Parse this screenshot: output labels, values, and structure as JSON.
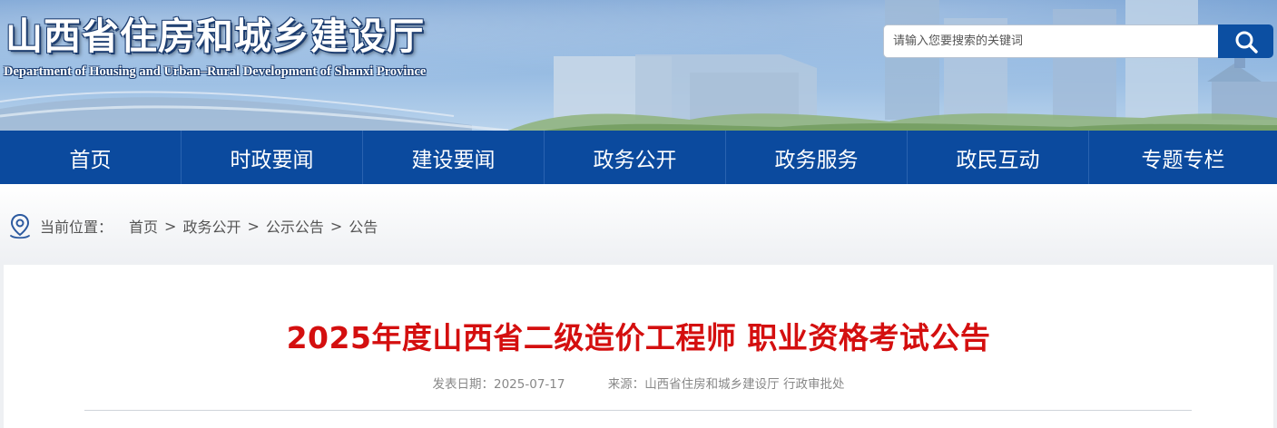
{
  "header": {
    "site_title": "山西省住房和城乡建设厅",
    "site_subtitle": "Department of Housing and Urban–Rural Development of Shanxi Province",
    "search_placeholder": "请输入您要搜索的关键词",
    "search_icon": "search-icon"
  },
  "nav": {
    "items": [
      {
        "label": "首页"
      },
      {
        "label": "时政要闻"
      },
      {
        "label": "建设要闻"
      },
      {
        "label": "政务公开"
      },
      {
        "label": "政务服务"
      },
      {
        "label": "政民互动"
      },
      {
        "label": "专题专栏"
      }
    ]
  },
  "breadcrumb": {
    "icon": "location-pin-icon",
    "label": "当前位置：",
    "items": [
      "首页",
      "政务公开",
      "公示公告",
      "公告"
    ],
    "separator": ">"
  },
  "article": {
    "title": "2025年度山西省二级造价工程师 职业资格考试公告",
    "date_label": "发表日期：",
    "date": "2025-07-17",
    "source_label": "来源：",
    "source": "山西省住房和城乡建设厅 行政审批处"
  },
  "colors": {
    "nav_bg": "#0b4a9e",
    "title_red": "#d40f0f",
    "search_btn": "#0c4fa2"
  }
}
